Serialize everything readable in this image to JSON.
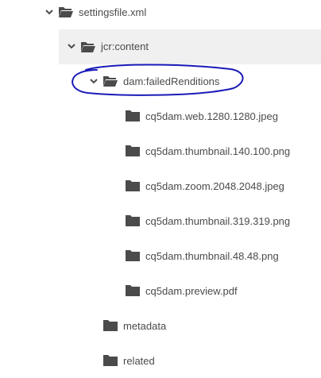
{
  "tree": {
    "root": {
      "label": "settingsfile.xml",
      "icon": "folder-open-icon"
    },
    "content": {
      "label": "jcr:content",
      "icon": "folder-open-icon"
    },
    "failed": {
      "label": "dam:failedRenditions",
      "icon": "folder-open-icon"
    },
    "renditions": [
      {
        "label": "cq5dam.web.1280.1280.jpeg",
        "icon": "folder-icon"
      },
      {
        "label": "cq5dam.thumbnail.140.100.png",
        "icon": "folder-icon"
      },
      {
        "label": "cq5dam.zoom.2048.2048.jpeg",
        "icon": "folder-icon"
      },
      {
        "label": "cq5dam.thumbnail.319.319.png",
        "icon": "folder-icon"
      },
      {
        "label": "cq5dam.thumbnail.48.48.png",
        "icon": "folder-icon"
      },
      {
        "label": "cq5dam.preview.pdf",
        "icon": "folder-icon"
      }
    ],
    "metadata": {
      "label": "metadata",
      "icon": "folder-icon"
    },
    "related": {
      "label": "related",
      "icon": "folder-icon"
    }
  },
  "colors": {
    "text": "#4b4b4b",
    "icon": "#4b4b4b",
    "selected_row": "#f0f0f0",
    "annotation": "#1a1ab8"
  }
}
